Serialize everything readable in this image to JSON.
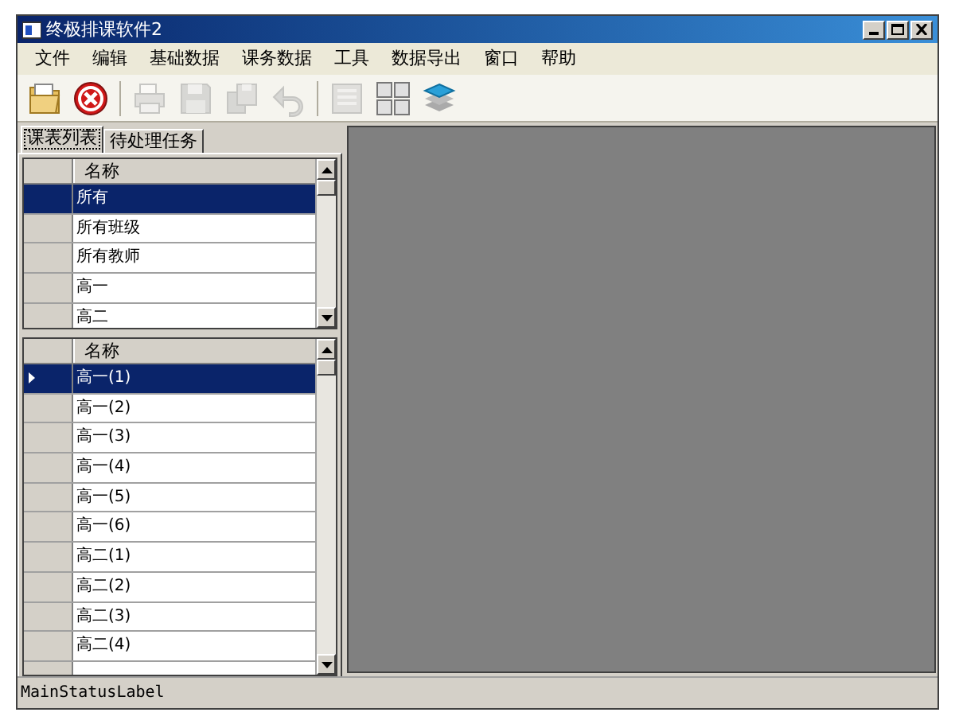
{
  "window": {
    "title": "终极排课软件2"
  },
  "menu": [
    "文件",
    "编辑",
    "基础数据",
    "课务数据",
    "工具",
    "数据导出",
    "窗口",
    "帮助"
  ],
  "toolbar": [
    {
      "kind": "folder",
      "disabled": false
    },
    {
      "kind": "cancel",
      "disabled": false
    },
    {
      "kind": "printer",
      "disabled": true
    },
    {
      "kind": "save",
      "disabled": true
    },
    {
      "kind": "save-all",
      "disabled": true
    },
    {
      "kind": "undo",
      "disabled": true
    },
    {
      "kind": "list",
      "disabled": true
    },
    {
      "kind": "numbers",
      "disabled": false
    },
    {
      "kind": "layers",
      "disabled": false
    }
  ],
  "tabs": [
    {
      "label": "课表列表",
      "selected": true
    },
    {
      "label": "待处理任务",
      "selected": false
    }
  ],
  "top_grid": {
    "column": "名称",
    "rows": [
      {
        "name": "所有",
        "selected": true
      },
      {
        "name": "所有班级",
        "selected": false
      },
      {
        "name": "所有教师",
        "selected": false
      },
      {
        "name": "高一",
        "selected": false
      },
      {
        "name": "高二",
        "selected": false
      }
    ]
  },
  "bottom_grid": {
    "column": "名称",
    "rows": [
      {
        "name": "高一(1)",
        "selected": true
      },
      {
        "name": "高一(2)",
        "selected": false
      },
      {
        "name": "高一(3)",
        "selected": false
      },
      {
        "name": "高一(4)",
        "selected": false
      },
      {
        "name": "高一(5)",
        "selected": false
      },
      {
        "name": "高一(6)",
        "selected": false
      },
      {
        "name": "高二(1)",
        "selected": false
      },
      {
        "name": "高二(2)",
        "selected": false
      },
      {
        "name": "高二(3)",
        "selected": false
      },
      {
        "name": "高二(4)",
        "selected": false
      }
    ]
  },
  "status_bar": {
    "text": "MainStatusLabel"
  }
}
